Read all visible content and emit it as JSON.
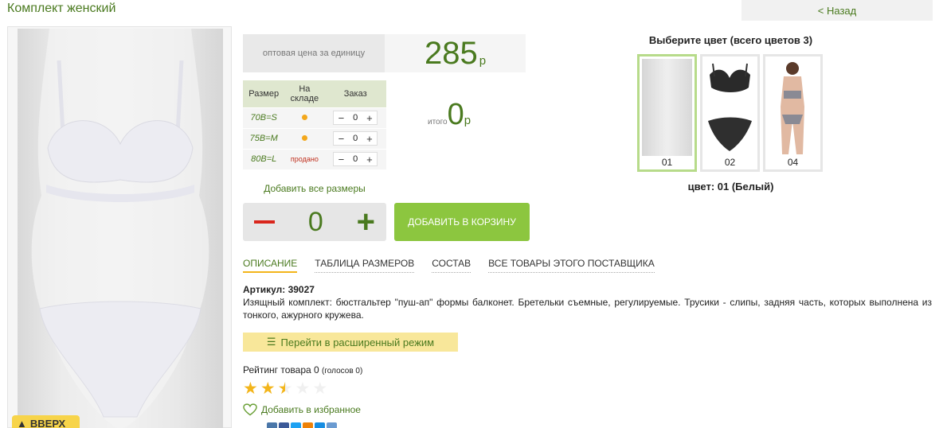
{
  "title": "Комплект женский",
  "back_label": "< Назад",
  "up_label": "ВВЕРХ",
  "price": {
    "label": "оптовая цена за единицу",
    "value": "285",
    "currency": "р"
  },
  "size_table": {
    "headers": [
      "Размер",
      "На складе",
      "Заказ"
    ],
    "rows": [
      {
        "size": "70B=S",
        "stock": "dot",
        "qty": "0"
      },
      {
        "size": "75B=M",
        "stock": "dot",
        "qty": "0"
      },
      {
        "size": "80B=L",
        "stock": "продано",
        "qty": "0"
      }
    ]
  },
  "total": {
    "label": "итого",
    "value": "0",
    "currency": "р"
  },
  "add_all_label": "Добавить все размеры",
  "big_stepper_value": "0",
  "cart_label": "ДОБАВИТЬ В КОРЗИНУ",
  "tabs": [
    "ОПИСАНИЕ",
    "ТАБЛИЦА РАЗМЕРОВ",
    "СОСТАВ",
    "ВСЕ ТОВАРЫ ЭТОГО ПОСТАВЩИКА"
  ],
  "article": "Артикул: 39027",
  "description": "Изящный комплект: бюстгальтер \"пуш-ап\" формы балконет. Бретельки съемные, регулируемые. Трусики - слипы, задняя часть, которых выполнена из тонкого, ажурного кружева.",
  "extended_mode_label": "Перейти в расширенный режим",
  "rating": {
    "label": "Рейтинг товара 0",
    "votes": "(голосов 0)",
    "stars_filled": 2.5,
    "stars_total": 5
  },
  "favorite_label": "Добавить в избранное",
  "colors": {
    "header": "Выберите цвет (всего цветов 3)",
    "items": [
      {
        "label": "01",
        "selected": true
      },
      {
        "label": "02",
        "selected": false
      },
      {
        "label": "04",
        "selected": false
      }
    ],
    "current": "цвет: 01 (Белый)"
  },
  "accent_colors": {
    "green": "#4a7a1f",
    "button": "#8cc63f",
    "star": "#f3b51b"
  }
}
